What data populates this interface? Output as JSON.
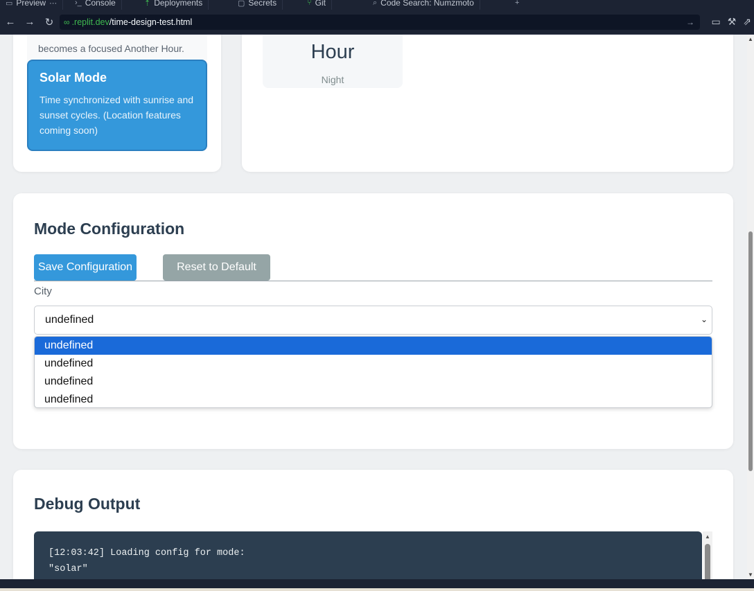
{
  "ide_tabs": [
    {
      "label": "Preview",
      "icon": "monitor-icon"
    },
    {
      "label": "Console",
      "icon": "terminal-icon"
    },
    {
      "label": "Deployments",
      "icon": "deploy-icon"
    },
    {
      "label": "Secrets",
      "icon": "lock-icon"
    },
    {
      "label": "Git",
      "icon": "git-icon"
    },
    {
      "label": "Code Search: Numzmoto",
      "icon": "search-icon"
    }
  ],
  "url": {
    "host": ".replit.dev",
    "path": "/time-design-test.html"
  },
  "modes": {
    "previous_desc_tail": "becomes a focused Another Hour.",
    "active": {
      "title": "Solar Mode",
      "description": "Time synchronized with sunrise and sunset cycles. (Location features coming soon)"
    }
  },
  "clock": {
    "hour_label": "Hour",
    "period": "Night"
  },
  "config": {
    "title": "Mode Configuration",
    "save_label": "Save Configuration",
    "reset_label": "Reset to Default",
    "city_label": "City",
    "city_selected": "undefined",
    "city_options": [
      "undefined",
      "undefined",
      "undefined",
      "undefined"
    ]
  },
  "debug": {
    "title": "Debug Output",
    "lines": [
      "[12:03:42] Loading config for mode:",
      "\"solar\""
    ]
  },
  "colors": {
    "accent": "#3498db",
    "heading": "#2c3e50",
    "reset": "#95a5a6",
    "console_bg": "#2c3e50"
  }
}
